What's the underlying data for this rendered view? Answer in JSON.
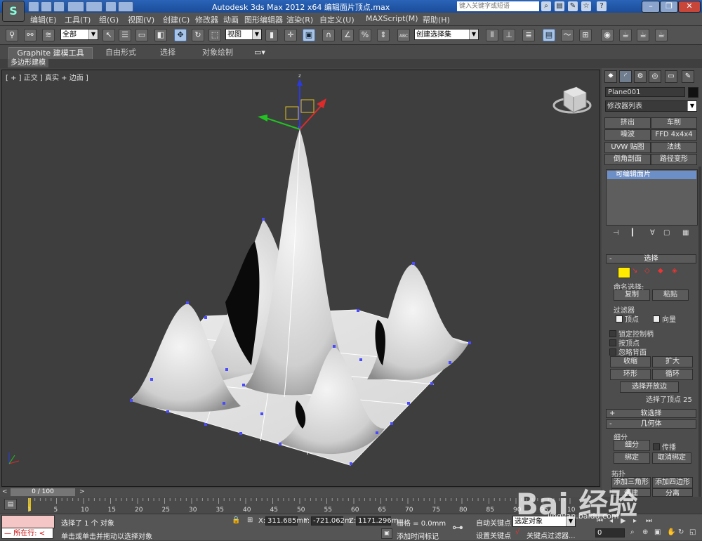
{
  "window": {
    "title": "Autodesk 3ds Max  2012 x64      编辑面片顶点.max",
    "search_placeholder": "键入关键字或短语",
    "logo": "S"
  },
  "menu": [
    "编辑(E)",
    "工具(T)",
    "组(G)",
    "视图(V)",
    "创建(C)",
    "修改器",
    "动画",
    "图形编辑器",
    "渲染(R)",
    "自定义(U)",
    "MAXScript(M)",
    "帮助(H)"
  ],
  "toolbar": {
    "selection_filter": "全部",
    "reference_coord": "视图",
    "named_selection": "创建选择集",
    "abc_label": "ABC"
  },
  "ribbon": {
    "tabs": [
      "Graphite 建模工具",
      "自由形式",
      "选择",
      "对象绘制"
    ],
    "subtab": "多边形建模"
  },
  "viewport": {
    "label": "[ + ] 正交 ] 真实 + 边面 ]"
  },
  "command_panel": {
    "object_name": "Plane001",
    "modifier_list": "修改器列表",
    "modifier_buttons": [
      "挤出",
      "车削",
      "噪波",
      "FFD 4x4x4",
      "UVW 贴图",
      "法线",
      "倒角剖面",
      "路径变形"
    ],
    "stack_item": "可编辑面片",
    "selection": {
      "title": "选择",
      "named_selection_label": "命名选择:",
      "copy": "复制",
      "paste": "粘贴",
      "filter_label": "过滤器",
      "vertex": "顶点",
      "vector": "向量",
      "lock_handles": "锁定控制柄",
      "by_vertex": "按顶点",
      "ignore_backfacing": "忽略背面",
      "shrink": "收缩",
      "grow": "扩大",
      "ring": "环形",
      "loop": "循环",
      "select_open_edges": "选择开放边",
      "status": "选择了顶点 25"
    },
    "soft_selection": "软选择",
    "geometry": {
      "title": "几何体",
      "subdivision": "细分",
      "subdivide": "细分",
      "propagate": "传播",
      "bind": "绑定",
      "unbind": "取消绑定",
      "topology": "拓扑",
      "add_tri": "添加三角形",
      "add_quad": "添加四边形",
      "create": "创建",
      "detach": "分离"
    }
  },
  "timeline": {
    "frame": "0 / 100",
    "ticks": [
      "0",
      "5",
      "10",
      "15",
      "20",
      "25",
      "30",
      "35",
      "40",
      "45",
      "50",
      "55",
      "60",
      "65",
      "70",
      "75",
      "80",
      "85",
      "90",
      "95",
      "100"
    ]
  },
  "status": {
    "maxscript_label": "所在行:",
    "selected": "选择了 1 个 对象",
    "prompt": "单击或单击并拖动以选择对象",
    "x_label": "X:",
    "x_value": "311.685mr",
    "y_label": "Y:",
    "y_value": "-721.062m",
    "z_label": "Z:",
    "z_value": "1171.296m",
    "grid": "栅格 = 0.0mm",
    "add_time_tag": "添加时间标记",
    "auto_key": "自动关键点",
    "set_key": "设置关键点",
    "key_mode": "选定对象",
    "key_filters": "关键点过滤器...",
    "current_frame": "0"
  },
  "watermark": {
    "brand": "Bai  经验",
    "url": "jingyan.baidu.com"
  }
}
